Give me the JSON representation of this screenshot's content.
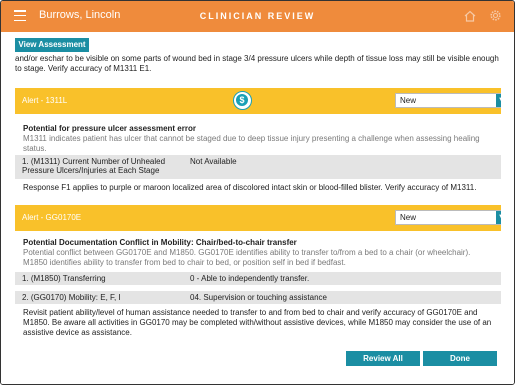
{
  "header": {
    "patient_name": "Burrows, Lincoln",
    "title": "CLINICIAN REVIEW"
  },
  "toolbar": {
    "view_assessment_label": "View Assessment"
  },
  "content": {
    "intro_text": "and/or eschar to be visible on some parts of wound bed in stage 3/4 pressure ulcers while depth of tissue loss may still be visible enough to stage. Verify accuracy of M1311 E1.",
    "alerts": [
      {
        "title": "Alert - 1311L",
        "status": "New",
        "heading": "Potential for pressure ulcer assessment error",
        "description": "M1311 indicates patient has ulcer that cannot be staged due to deep tissue injury presenting a challenge when assessing healing status.",
        "rows": [
          {
            "label": "1. (M1311)  Current Number of Unhealed Pressure Ulcers/Injuries at Each Stage",
            "value": "Not Available"
          }
        ],
        "note": "Response F1 applies to purple or maroon localized area of discolored intact skin or blood-filled blister. Verify accuracy of M1311."
      },
      {
        "title": "Alert - GG0170E",
        "status": "New",
        "heading": "Potential Documentation Conflict in Mobility: Chair/bed-to-chair transfer",
        "description": "Potential conflict between GG0170E and M1850. GG0170E identifies ability to transfer to/from a bed to a chair (or wheelchair). M1850 identifies ability to transfer from bed to chair to bed, or position self in bed if bedfast.",
        "rows": [
          {
            "label": "1. (M1850)  Transferring",
            "value": "0 - Able to independently transfer."
          },
          {
            "label": "2. (GG0170) Mobility: E, F, I",
            "value": "04. Supervision or touching assistance"
          }
        ],
        "note": "Revisit patient ability/level of human assistance needed to transfer to and from bed to chair and verify accuracy of GG0170E and M1850. Be aware all activities in GG0170 may be completed with/without assistive devices, while M1850 may consider the use of an assistive device as assistance."
      }
    ]
  },
  "footer": {
    "review_all_label": "Review All",
    "done_label": "Done"
  },
  "colors": {
    "header_bg": "#ef8b3c",
    "alert_bar": "#f9c12a",
    "accent": "#1b8ea3"
  },
  "icons": [
    "menu-icon",
    "home-icon",
    "gear-icon",
    "dollar-icon",
    "chevron-down-icon"
  ]
}
